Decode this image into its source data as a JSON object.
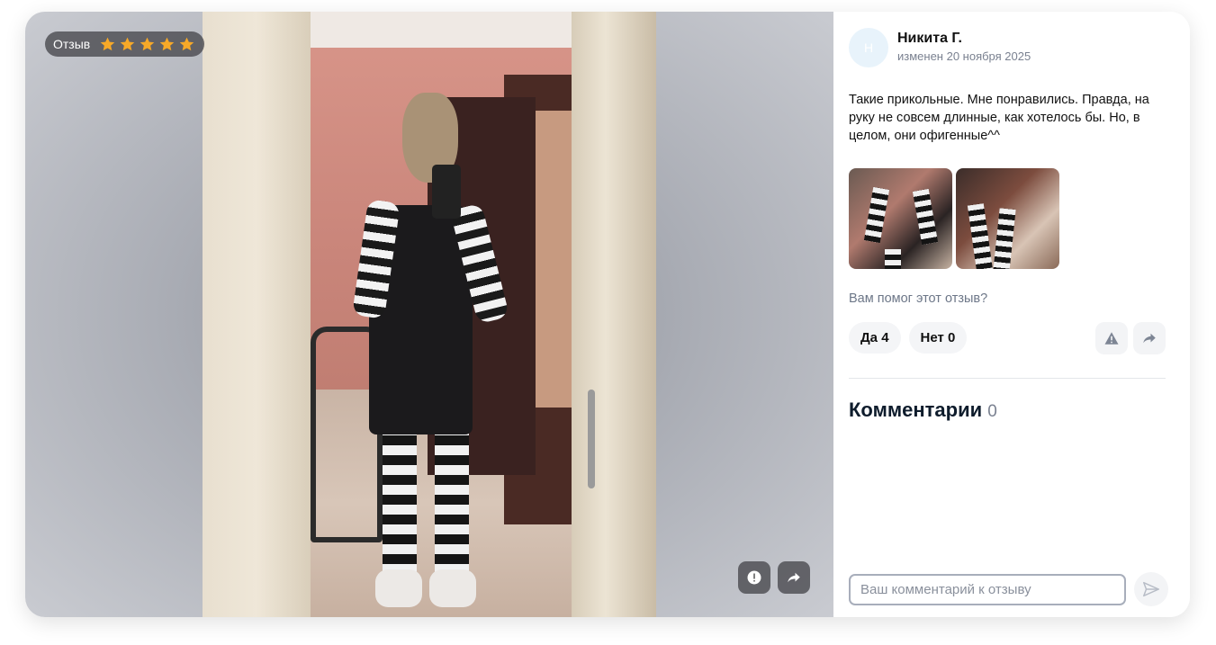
{
  "media": {
    "badge_label": "Отзыв",
    "rating": 5,
    "rating_max": 5,
    "star_color": "#f7a928",
    "actions": [
      {
        "icon": "warning-icon"
      },
      {
        "icon": "share-icon"
      }
    ]
  },
  "review": {
    "avatar_initial": "Н",
    "author": "Никита Г.",
    "date": "изменен 20 ноября 2025",
    "text": "Такие прикольные. Мне понравились. Правда, на руку не совсем длинные, как хотелось бы. Но, в целом, они офигенные^^",
    "thumbnails": [
      {
        "icon": "photo-thumbnail-1"
      },
      {
        "icon": "photo-thumbnail-2"
      }
    ],
    "helpful_question": "Вам помог этот отзыв?",
    "yes_label": "Да 4",
    "no_label": "Нет 0"
  },
  "comments": {
    "title": "Комментарии",
    "count": "0",
    "input_placeholder": "Ваш комментарий к отзыву",
    "send_icon": "send-icon"
  }
}
